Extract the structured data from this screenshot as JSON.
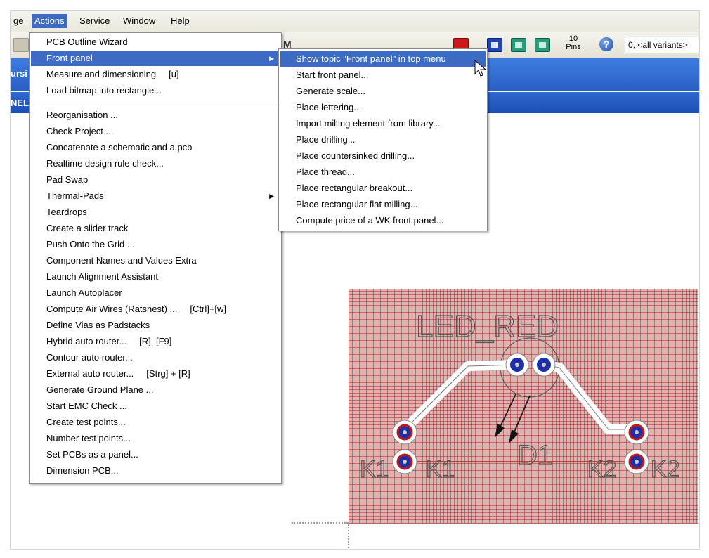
{
  "menubar": {
    "items": [
      "ge",
      "Actions",
      "Service",
      "Window",
      "Help"
    ],
    "active": "Actions"
  },
  "toolbar": {
    "pins_number": "10",
    "pins_label": "Pins",
    "variant_value": "0, <all variants>",
    "help_glyph": "?",
    "colors": {
      "red_button": "#cc1a1a",
      "green_button": "#2b9a7a",
      "blue_button": "#2045b4"
    }
  },
  "bluebar": {
    "text1": "ursi",
    "text2": "NEL"
  },
  "actions_menu": {
    "group1": [
      {
        "label": "PCB Outline Wizard"
      },
      {
        "label": "Front panel",
        "submenu": true,
        "highlighted": true
      },
      {
        "label": "Measure and dimensioning",
        "shortcut": "[u]"
      },
      {
        "label": "Load bitmap into rectangle..."
      }
    ],
    "group2": [
      {
        "label": "Reorganisation ..."
      },
      {
        "label": "Check Project ..."
      },
      {
        "label": "Concatenate a schematic and a pcb"
      },
      {
        "label": "Realtime design rule check..."
      },
      {
        "label": "Pad Swap"
      },
      {
        "label": "Thermal-Pads",
        "submenu": true
      },
      {
        "label": "Teardrops"
      },
      {
        "label": "Create a slider track"
      },
      {
        "label": "Push Onto the Grid ..."
      },
      {
        "label": "Component Names and Values Extra"
      },
      {
        "label": "Launch Alignment Assistant"
      },
      {
        "label": "Launch Autoplacer"
      },
      {
        "label": "Compute Air Wires (Ratsnest) ...",
        "shortcut": "[Ctrl]+[w]"
      },
      {
        "label": "Define Vias as Padstacks"
      },
      {
        "label": "Hybrid auto router...",
        "shortcut": "[R], [F9]"
      },
      {
        "label": "Contour auto router..."
      },
      {
        "label": "External auto router...",
        "shortcut": "[Strg] + [R]"
      },
      {
        "label": "Generate Ground Plane ..."
      },
      {
        "label": "Start EMC Check ..."
      },
      {
        "label": "Create test points..."
      },
      {
        "label": "Number test points..."
      },
      {
        "label": "Set PCBs as a panel..."
      },
      {
        "label": "Dimension PCB..."
      }
    ]
  },
  "front_panel_submenu": {
    "items": [
      {
        "label": "Show topic \"Front panel\" in top menu",
        "highlighted": true
      },
      {
        "label": "Start front panel..."
      },
      {
        "label": "Generate scale..."
      },
      {
        "label": "Place lettering..."
      },
      {
        "label": "Import milling element from library..."
      },
      {
        "label": "Place drilling..."
      },
      {
        "label": "Place countersinked drilling..."
      },
      {
        "label": "Place thread..."
      },
      {
        "label": "Place rectangular breakout..."
      },
      {
        "label": "Place rectangular flat milling..."
      },
      {
        "label": "Compute price of a WK front panel..."
      }
    ]
  },
  "pcb": {
    "component_value": "LED_RED",
    "component_name": "D1",
    "left_silk_1": "K1",
    "left_silk_2": "K1",
    "right_silk_1": "K2",
    "right_silk_2": "K2",
    "board_color": "#d8b6b6",
    "grid_color": "#b42828",
    "pad_color": "#1f2fa8",
    "pad_ring_color": "#c01818"
  }
}
